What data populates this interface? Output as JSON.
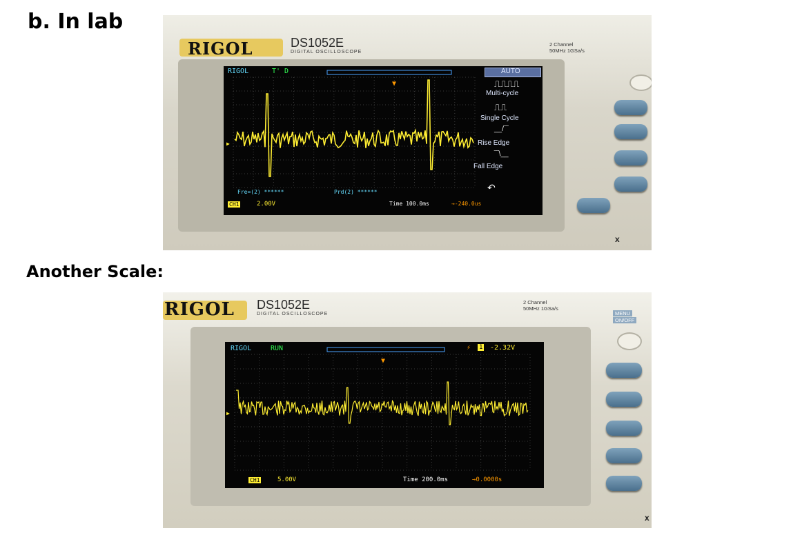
{
  "headings": {
    "first": "b. In lab",
    "second": "Another Scale:"
  },
  "photo1": {
    "brand": "RIGOL",
    "model": "DS1052E",
    "subtitle": "DIGITAL OSCILLOSCOPE",
    "spec_line1": "2 Channel",
    "spec_line2": "50MHz 1GSa/s",
    "screen": {
      "logo": "RIGOL",
      "status": "T' D",
      "menu": [
        "AUTO",
        "Multi-cycle",
        "Single Cycle",
        "Rise Edge",
        "Fall Edge"
      ],
      "freq_label": "Fre=(2) ******",
      "period_label": "Prd(2) ******",
      "ch1_label": "CH1",
      "volts": "2.00V",
      "time": "Time 100.0ms",
      "offset": "→-240.0us"
    },
    "edge_mark": "x"
  },
  "photo2": {
    "brand": "RIGOL",
    "model": "DS1052E",
    "subtitle": "DIGITAL OSCILLOSCOPE",
    "spec_line1": "2 Channel",
    "spec_line2": "50MHz 1GSa/s",
    "menu_key_line1": "MENU",
    "menu_key_line2": "ON/OFF",
    "screen": {
      "logo": "RIGOL",
      "status": "RUN",
      "trigger_channel": "1",
      "trigger_level": "-2.32V",
      "ch1_label": "CH1",
      "volts": "5.00V",
      "time": "Time 200.0ms",
      "offset": "→0.0000s"
    },
    "edge_mark": "x"
  },
  "colors": {
    "trace": "#ffee33",
    "screen_text_cyan": "#66ddff",
    "status_green": "#33ff55"
  }
}
